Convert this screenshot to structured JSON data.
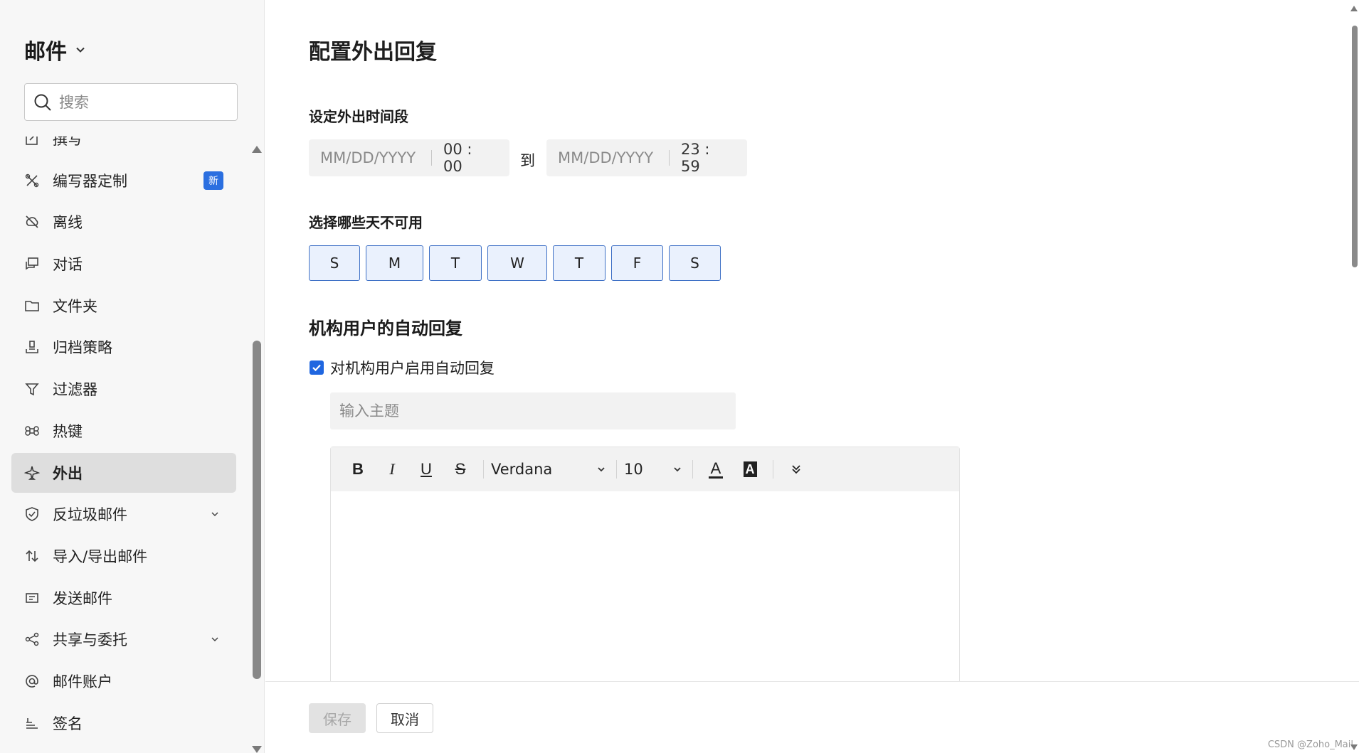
{
  "sidebar": {
    "title": "邮件",
    "search_placeholder": "搜索",
    "items": [
      {
        "label": "撰写",
        "icon": "compose-icon"
      },
      {
        "label": "编写器定制",
        "icon": "tools-icon",
        "badge": "新"
      },
      {
        "label": "离线",
        "icon": "offline-icon"
      },
      {
        "label": "对话",
        "icon": "conversation-icon"
      },
      {
        "label": "文件夹",
        "icon": "folder-icon"
      },
      {
        "label": "归档策略",
        "icon": "archive-icon"
      },
      {
        "label": "过滤器",
        "icon": "filter-icon"
      },
      {
        "label": "热键",
        "icon": "command-key-icon"
      },
      {
        "label": "外出",
        "icon": "airplane-icon",
        "active": true
      },
      {
        "label": "反垃圾邮件",
        "icon": "shield-check-icon",
        "expandable": true
      },
      {
        "label": "导入/导出邮件",
        "icon": "import-export-icon"
      },
      {
        "label": "发送邮件",
        "icon": "send-mail-icon"
      },
      {
        "label": "共享与委托",
        "icon": "share-icon",
        "expandable": true
      },
      {
        "label": "邮件账户",
        "icon": "at-icon"
      },
      {
        "label": "签名",
        "icon": "signature-icon"
      }
    ]
  },
  "main": {
    "title": "配置外出回复",
    "period": {
      "heading": "设定外出时间段",
      "start_date_placeholder": "MM/DD/YYYY",
      "start_time": "00 : 00",
      "to_label": "到",
      "end_date_placeholder": "MM/DD/YYYY",
      "end_time": "23 : 59"
    },
    "days": {
      "heading": "选择哪些天不可用",
      "labels": [
        "S",
        "M",
        "T",
        "W",
        "T",
        "F",
        "S"
      ]
    },
    "auto_reply": {
      "heading": "机构用户的自动回复",
      "checkbox_label": "对机构用户启用自动回复",
      "checked": true,
      "subject_placeholder": "输入主题"
    },
    "toolbar": {
      "bold": "B",
      "italic": "I",
      "underline": "U",
      "strike": "S",
      "font": "Verdana",
      "size": "10",
      "text_color_glyph": "A",
      "bg_color_glyph": "A"
    },
    "footer": {
      "save_label": "保存",
      "cancel_label": "取消",
      "watermark": "CSDN @Zoho_Mail"
    }
  },
  "colors": {
    "accent": "#1f66e0",
    "badge": "#2b6fe0",
    "day_border": "#3d6fc5",
    "day_bg": "#eaf1fd"
  }
}
